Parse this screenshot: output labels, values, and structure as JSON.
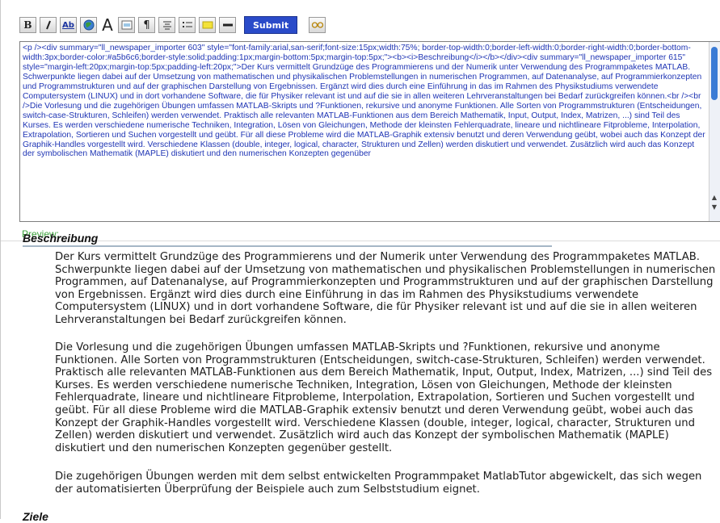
{
  "toolbar": {
    "bold": "B",
    "italic": "I",
    "underline": "Ab",
    "font_size": "A",
    "submit": "Submit"
  },
  "editor": {
    "content": "<p /><div summary=\"ll_newspaper_importer 603\" style=\"font-family:arial,san-serif;font-size:15px;width:75%; border-top-width:0;border-left-width:0;border-right-width:0;border-bottom-width:3px;border-color:#a5b6c6;border-style:solid;padding:1px;margin-bottom:5px;margin-top:5px;\"><b><i>Beschreibung</i></b></div><div summary=\"ll_newspaper_importer 615\" style=\"margin-left:20px;margin-top:5px;padding-left:20px;\">Der Kurs vermittelt Grundzüge des Programmierens und der Numerik unter Verwendung des Programmpaketes MATLAB. Schwerpunkte liegen dabei auf der Umsetzung von mathematischen und physikalischen Problemstellungen in numerischen Programmen, auf Datenanalyse, auf Programmierkonzepten und Programmstrukturen und auf der graphischen Darstellung von Ergebnissen. Ergänzt wird dies durch eine Einführung in das im Rahmen des Physikstudiums verwendete Computersystem (LINUX) und in dort vorhandene Software, die für Physiker relevant ist und auf die sie in allen weiteren Lehrveranstaltungen bei Bedarf zurückgreifen können.<br /><br />Die Vorlesung und die zugehörigen Übungen umfassen MATLAB-Skripts und ?Funktionen, rekursive und anonyme Funktionen. Alle Sorten von Programmstrukturen (Entscheidungen, switch-case-Strukturen, Schleifen) werden verwendet. Praktisch alle relevanten MATLAB-Funktionen aus dem Bereich Mathematik, Input, Output, Index, Matrizen, ...) sind Teil des Kurses. Es werden verschiedene numerische Techniken, Integration, Lösen von Gleichungen, Methode der kleinsten Fehlerquadrate, lineare und nichtlineare Fitprobleme, Interpolation, Extrapolation, Sortieren und Suchen vorgestellt und geübt. Für all diese Probleme wird die MATLAB-Graphik extensiv benutzt und deren Verwendung geübt, wobei auch das Konzept der Graphik-Handles vorgestellt wird. Verschiedene Klassen (double, integer, logical, character, Strukturen und Zellen) werden diskutiert und verwendet. Zusätzlich wird auch das Konzept der symbolischen Mathematik (MAPLE) diskutiert und den numerischen Konzepten gegenüber"
  },
  "preview": {
    "label": "Preview:",
    "heading_1": "Beschreibung",
    "paragraph_1": "Der Kurs vermittelt Grundzüge des Programmierens und der Numerik unter Verwendung des Programmpaketes MATLAB. Schwerpunkte liegen dabei auf der Umsetzung von mathematischen und physikalischen Problemstellungen in numerischen Programmen, auf Datenanalyse, auf Programmierkonzepten und Programmstrukturen und auf der graphischen Darstellung von Ergebnissen. Ergänzt wird dies durch eine Einführung in das im Rahmen des Physikstudiums verwendete Computersystem (LINUX) und in dort vorhandene Software, die für Physiker relevant ist und auf die sie in allen weiteren Lehrveranstaltungen bei Bedarf zurückgreifen können.",
    "paragraph_2": "Die Vorlesung und die zugehörigen Übungen umfassen MATLAB-Skripts und ?Funktionen, rekursive und anonyme Funktionen. Alle Sorten von Programmstrukturen (Entscheidungen, switch-case-Strukturen, Schleifen) werden verwendet. Praktisch alle relevanten MATLAB-Funktionen aus dem Bereich Mathematik, Input, Output, Index, Matrizen, ...) sind Teil des Kurses. Es werden verschiedene numerische Techniken, Integration, Lösen von Gleichungen, Methode der kleinsten Fehlerquadrate, lineare und nichtlineare Fitprobleme, Interpolation, Extrapolation, Sortieren und Suchen vorgestellt und geübt. Für all diese Probleme wird die MATLAB-Graphik extensiv benutzt und deren Verwendung geübt, wobei auch das Konzept der Graphik-Handles vorgestellt wird. Verschiedene Klassen (double, integer, logical, character, Strukturen und Zellen) werden diskutiert und verwendet. Zusätzlich wird auch das Konzept der symbolischen Mathematik (MAPLE) diskutiert und den numerischen Konzepten gegenüber gestellt.",
    "paragraph_3": "Die zugehörigen Übungen werden mit dem selbst entwickelten Programmpaket MatlabTutor abgewickelt, das sich wegen der automatisierten Überprüfung der Beispiele auch zum Selbststudium eignet.",
    "heading_2": "Ziele"
  }
}
